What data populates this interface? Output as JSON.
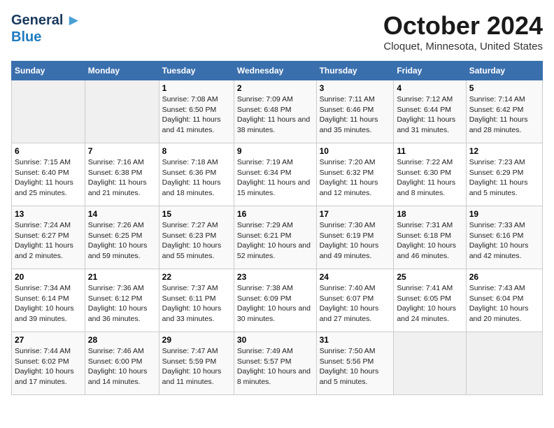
{
  "logo": {
    "general": "General",
    "blue": "Blue",
    "tagline": ""
  },
  "title": "October 2024",
  "location": "Cloquet, Minnesota, United States",
  "weekdays": [
    "Sunday",
    "Monday",
    "Tuesday",
    "Wednesday",
    "Thursday",
    "Friday",
    "Saturday"
  ],
  "weeks": [
    [
      {
        "day": "",
        "info": ""
      },
      {
        "day": "",
        "info": ""
      },
      {
        "day": "1",
        "sunrise": "Sunrise: 7:08 AM",
        "sunset": "Sunset: 6:50 PM",
        "daylight": "Daylight: 11 hours and 41 minutes."
      },
      {
        "day": "2",
        "sunrise": "Sunrise: 7:09 AM",
        "sunset": "Sunset: 6:48 PM",
        "daylight": "Daylight: 11 hours and 38 minutes."
      },
      {
        "day": "3",
        "sunrise": "Sunrise: 7:11 AM",
        "sunset": "Sunset: 6:46 PM",
        "daylight": "Daylight: 11 hours and 35 minutes."
      },
      {
        "day": "4",
        "sunrise": "Sunrise: 7:12 AM",
        "sunset": "Sunset: 6:44 PM",
        "daylight": "Daylight: 11 hours and 31 minutes."
      },
      {
        "day": "5",
        "sunrise": "Sunrise: 7:14 AM",
        "sunset": "Sunset: 6:42 PM",
        "daylight": "Daylight: 11 hours and 28 minutes."
      }
    ],
    [
      {
        "day": "6",
        "sunrise": "Sunrise: 7:15 AM",
        "sunset": "Sunset: 6:40 PM",
        "daylight": "Daylight: 11 hours and 25 minutes."
      },
      {
        "day": "7",
        "sunrise": "Sunrise: 7:16 AM",
        "sunset": "Sunset: 6:38 PM",
        "daylight": "Daylight: 11 hours and 21 minutes."
      },
      {
        "day": "8",
        "sunrise": "Sunrise: 7:18 AM",
        "sunset": "Sunset: 6:36 PM",
        "daylight": "Daylight: 11 hours and 18 minutes."
      },
      {
        "day": "9",
        "sunrise": "Sunrise: 7:19 AM",
        "sunset": "Sunset: 6:34 PM",
        "daylight": "Daylight: 11 hours and 15 minutes."
      },
      {
        "day": "10",
        "sunrise": "Sunrise: 7:20 AM",
        "sunset": "Sunset: 6:32 PM",
        "daylight": "Daylight: 11 hours and 12 minutes."
      },
      {
        "day": "11",
        "sunrise": "Sunrise: 7:22 AM",
        "sunset": "Sunset: 6:30 PM",
        "daylight": "Daylight: 11 hours and 8 minutes."
      },
      {
        "day": "12",
        "sunrise": "Sunrise: 7:23 AM",
        "sunset": "Sunset: 6:29 PM",
        "daylight": "Daylight: 11 hours and 5 minutes."
      }
    ],
    [
      {
        "day": "13",
        "sunrise": "Sunrise: 7:24 AM",
        "sunset": "Sunset: 6:27 PM",
        "daylight": "Daylight: 11 hours and 2 minutes."
      },
      {
        "day": "14",
        "sunrise": "Sunrise: 7:26 AM",
        "sunset": "Sunset: 6:25 PM",
        "daylight": "Daylight: 10 hours and 59 minutes."
      },
      {
        "day": "15",
        "sunrise": "Sunrise: 7:27 AM",
        "sunset": "Sunset: 6:23 PM",
        "daylight": "Daylight: 10 hours and 55 minutes."
      },
      {
        "day": "16",
        "sunrise": "Sunrise: 7:29 AM",
        "sunset": "Sunset: 6:21 PM",
        "daylight": "Daylight: 10 hours and 52 minutes."
      },
      {
        "day": "17",
        "sunrise": "Sunrise: 7:30 AM",
        "sunset": "Sunset: 6:19 PM",
        "daylight": "Daylight: 10 hours and 49 minutes."
      },
      {
        "day": "18",
        "sunrise": "Sunrise: 7:31 AM",
        "sunset": "Sunset: 6:18 PM",
        "daylight": "Daylight: 10 hours and 46 minutes."
      },
      {
        "day": "19",
        "sunrise": "Sunrise: 7:33 AM",
        "sunset": "Sunset: 6:16 PM",
        "daylight": "Daylight: 10 hours and 42 minutes."
      }
    ],
    [
      {
        "day": "20",
        "sunrise": "Sunrise: 7:34 AM",
        "sunset": "Sunset: 6:14 PM",
        "daylight": "Daylight: 10 hours and 39 minutes."
      },
      {
        "day": "21",
        "sunrise": "Sunrise: 7:36 AM",
        "sunset": "Sunset: 6:12 PM",
        "daylight": "Daylight: 10 hours and 36 minutes."
      },
      {
        "day": "22",
        "sunrise": "Sunrise: 7:37 AM",
        "sunset": "Sunset: 6:11 PM",
        "daylight": "Daylight: 10 hours and 33 minutes."
      },
      {
        "day": "23",
        "sunrise": "Sunrise: 7:38 AM",
        "sunset": "Sunset: 6:09 PM",
        "daylight": "Daylight: 10 hours and 30 minutes."
      },
      {
        "day": "24",
        "sunrise": "Sunrise: 7:40 AM",
        "sunset": "Sunset: 6:07 PM",
        "daylight": "Daylight: 10 hours and 27 minutes."
      },
      {
        "day": "25",
        "sunrise": "Sunrise: 7:41 AM",
        "sunset": "Sunset: 6:05 PM",
        "daylight": "Daylight: 10 hours and 24 minutes."
      },
      {
        "day": "26",
        "sunrise": "Sunrise: 7:43 AM",
        "sunset": "Sunset: 6:04 PM",
        "daylight": "Daylight: 10 hours and 20 minutes."
      }
    ],
    [
      {
        "day": "27",
        "sunrise": "Sunrise: 7:44 AM",
        "sunset": "Sunset: 6:02 PM",
        "daylight": "Daylight: 10 hours and 17 minutes."
      },
      {
        "day": "28",
        "sunrise": "Sunrise: 7:46 AM",
        "sunset": "Sunset: 6:00 PM",
        "daylight": "Daylight: 10 hours and 14 minutes."
      },
      {
        "day": "29",
        "sunrise": "Sunrise: 7:47 AM",
        "sunset": "Sunset: 5:59 PM",
        "daylight": "Daylight: 10 hours and 11 minutes."
      },
      {
        "day": "30",
        "sunrise": "Sunrise: 7:49 AM",
        "sunset": "Sunset: 5:57 PM",
        "daylight": "Daylight: 10 hours and 8 minutes."
      },
      {
        "day": "31",
        "sunrise": "Sunrise: 7:50 AM",
        "sunset": "Sunset: 5:56 PM",
        "daylight": "Daylight: 10 hours and 5 minutes."
      },
      {
        "day": "",
        "info": ""
      },
      {
        "day": "",
        "info": ""
      }
    ]
  ]
}
